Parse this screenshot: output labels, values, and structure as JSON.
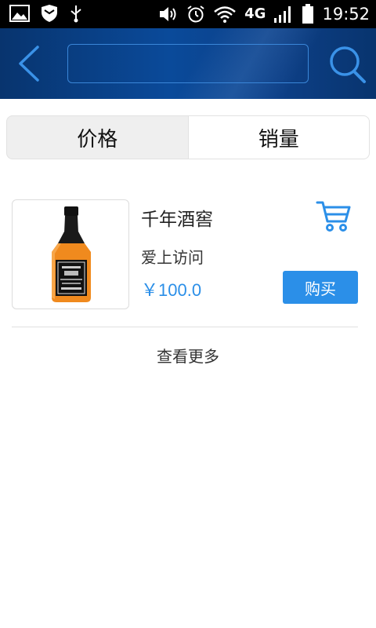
{
  "status_bar": {
    "time": "19:52",
    "network": "4G",
    "icons": [
      "image-icon",
      "shield-icon",
      "usb-icon",
      "volume-icon",
      "alarm-icon",
      "wifi-icon",
      "signal-icon",
      "battery-icon"
    ]
  },
  "header": {
    "search": {
      "value": "",
      "placeholder": ""
    },
    "accent": "#3a86d8"
  },
  "sort_tabs": [
    {
      "label": "价格",
      "active": true
    },
    {
      "label": "销量",
      "active": false
    }
  ],
  "products": [
    {
      "name": "千年酒窖",
      "subtitle": "爱上访问",
      "price": "￥100.0",
      "buy_label": "购买",
      "image": "whiskey-bottle"
    }
  ],
  "load_more": "查看更多",
  "colors": {
    "header_bg": "#0a4a9a",
    "accent_blue": "#2b8fe8",
    "status_bar": "#000000"
  }
}
